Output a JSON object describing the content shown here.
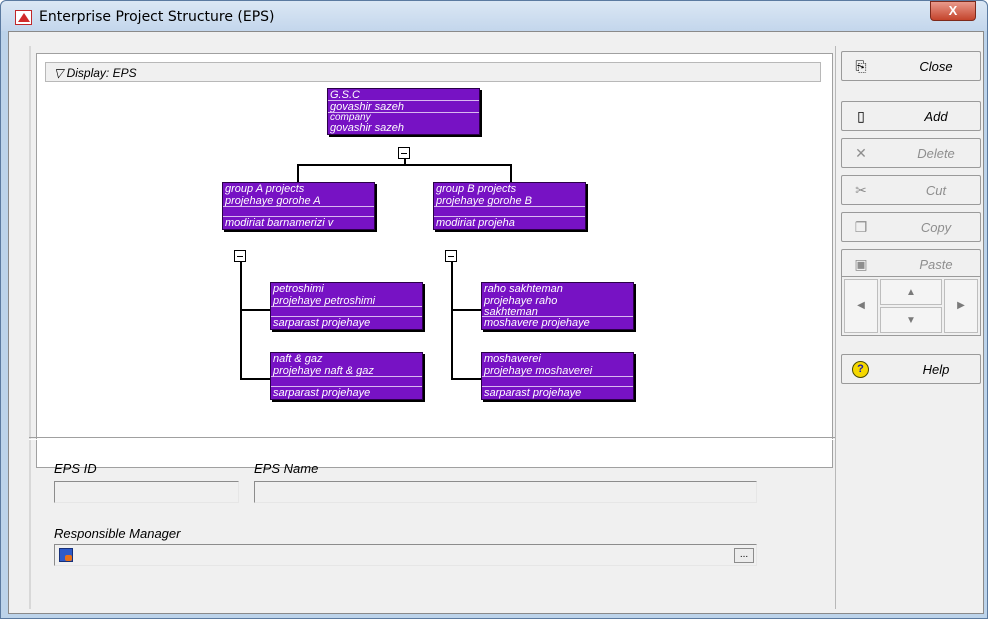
{
  "window": {
    "title": "Enterprise Project Structure (EPS)",
    "close_glyph": "X"
  },
  "tree": {
    "display_label": "Display: EPS",
    "root": {
      "lines": [
        "G.S.C",
        "govashir sazeh",
        "company",
        "govashir sazeh"
      ]
    },
    "group_a": {
      "lines": [
        "group A projects",
        "projehaye gorohe A",
        "",
        "modiriat barnamerizi v"
      ],
      "children": [
        {
          "lines": [
            "petroshimi",
            "projehaye petroshimi",
            "",
            "sarparast projehaye"
          ]
        },
        {
          "lines": [
            "naft & gaz",
            "projehaye naft & gaz",
            "",
            "sarparast projehaye"
          ]
        }
      ]
    },
    "group_b": {
      "lines": [
        "group B projects",
        "projehaye gorohe B",
        "",
        "modiriat projeha"
      ],
      "children": [
        {
          "lines": [
            "raho sakhteman",
            "projehaye raho",
            "sakhteman",
            "moshavere projehaye"
          ]
        },
        {
          "lines": [
            "moshaverei",
            "projehaye moshaverei",
            "",
            "sarparast projehaye"
          ]
        }
      ]
    }
  },
  "form": {
    "eps_id_label": "EPS ID",
    "eps_id_value": "",
    "eps_name_label": "EPS Name",
    "eps_name_value": "",
    "manager_label": "Responsible Manager",
    "manager_value": "",
    "ellipsis": "..."
  },
  "buttons": {
    "close": "Close",
    "add": "Add",
    "delete": "Delete",
    "cut": "Cut",
    "copy": "Copy",
    "paste": "Paste",
    "help": "Help"
  },
  "colors": {
    "node_fill": "#7712c4",
    "node_text": "#ffffff",
    "title_close": "#c4442c"
  },
  "icons": {
    "close": "close-panel-icon",
    "add": "new-document-icon",
    "delete": "x-delete-icon",
    "cut": "scissors-icon",
    "copy": "copy-icon",
    "paste": "clipboard-icon",
    "help": "help-icon",
    "manager": "user-icon"
  }
}
